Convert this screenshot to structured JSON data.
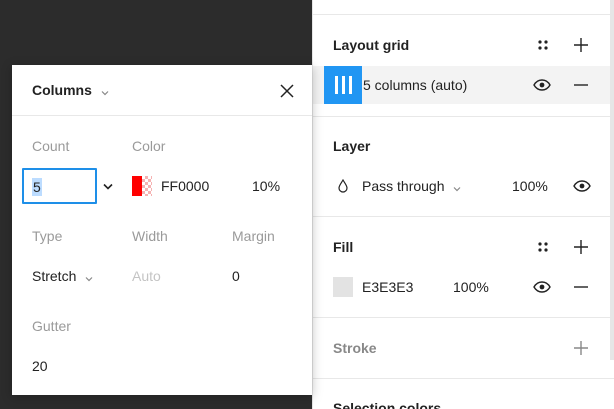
{
  "properties_panel": {
    "layout_grid": {
      "title": "Layout grid",
      "grid_item_label": "5 columns (auto)"
    },
    "layer": {
      "title": "Layer",
      "blend_mode": "Pass through",
      "opacity": "100%"
    },
    "fill": {
      "title": "Fill",
      "hex": "E3E3E3",
      "opacity": "100%",
      "swatch_color": "#E3E3E3"
    },
    "stroke": {
      "title": "Stroke"
    },
    "selection_colors": {
      "title": "Selection colors"
    }
  },
  "grid_popup": {
    "grid_type": "Columns",
    "count_label": "Count",
    "count_value": "5",
    "color_label": "Color",
    "color_hex": "FF0000",
    "color_opacity": "10%",
    "color_swatch": "#FF0000",
    "type_label": "Type",
    "type_value": "Stretch",
    "width_label": "Width",
    "width_placeholder": "Auto",
    "margin_label": "Margin",
    "margin_value": "0",
    "gutter_label": "Gutter",
    "gutter_value": "20"
  },
  "colors": {
    "accent": "#1E8FE8",
    "grid_thumb": "#2196F3",
    "canvas_bg": "#2C2C2C"
  }
}
